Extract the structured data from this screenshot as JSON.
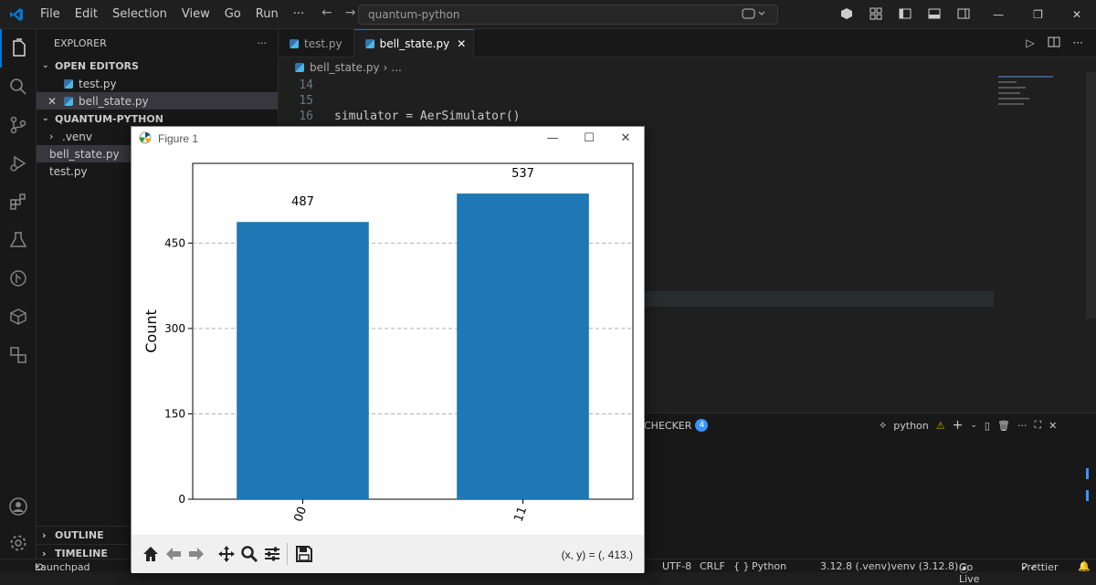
{
  "titlebar": {
    "menu": [
      "File",
      "Edit",
      "Selection",
      "View",
      "Go",
      "Run",
      "···"
    ],
    "search": "quantum-python"
  },
  "sidebar": {
    "title": "EXPLORER",
    "more": "···",
    "open_editors": {
      "label": "OPEN EDITORS",
      "items": [
        {
          "name": "test.py"
        },
        {
          "name": "bell_state.py"
        }
      ]
    },
    "workspace": {
      "label": "QUANTUM-PYTHON",
      "items": [
        {
          "name": ".venv"
        },
        {
          "name": "bell_state.py"
        },
        {
          "name": "test.py"
        }
      ]
    },
    "outline": "OUTLINE",
    "timeline": "TIMELINE"
  },
  "editor": {
    "tabs": [
      {
        "label": "test.py"
      },
      {
        "label": "bell_state.py"
      }
    ],
    "breadcrumb": {
      "file": "bell_state.py",
      "rest": "..."
    },
    "lines": [
      {
        "num": "14",
        "text": ""
      },
      {
        "num": "15",
        "text": ""
      },
      {
        "num": "16",
        "text": "simulator = AerSimulator()"
      }
    ]
  },
  "panel": {
    "problems_tab": "CHECKER",
    "problems_count": "4",
    "terminal_label": "python",
    "terminal_warning": "⚠"
  },
  "statusbar": {
    "launchpad": "Launchpad",
    "encoding": "UTF-8",
    "eol": "CRLF",
    "braces": "{ }",
    "language": "Python",
    "interpreter": "3.12.8 (.venv)",
    "env": ".venv (3.12.8)",
    "golive": "Go Live",
    "prettier": "Prettier"
  },
  "figure": {
    "title": "Figure 1",
    "coords": "(x, y) = (, 413.)"
  },
  "colors": {
    "bar": "#1f77b4",
    "accent": "#0078d4",
    "badge": "#3794ff"
  },
  "chart_data": {
    "type": "bar",
    "categories": [
      "00",
      "11"
    ],
    "values": [
      487,
      537
    ],
    "ylabel": "Count",
    "xlabel": "",
    "yticks": [
      0,
      150,
      300,
      450
    ],
    "ylim": [
      0,
      590
    ],
    "grid": "horizontal dashed",
    "data_labels": [
      "487",
      "537"
    ]
  }
}
